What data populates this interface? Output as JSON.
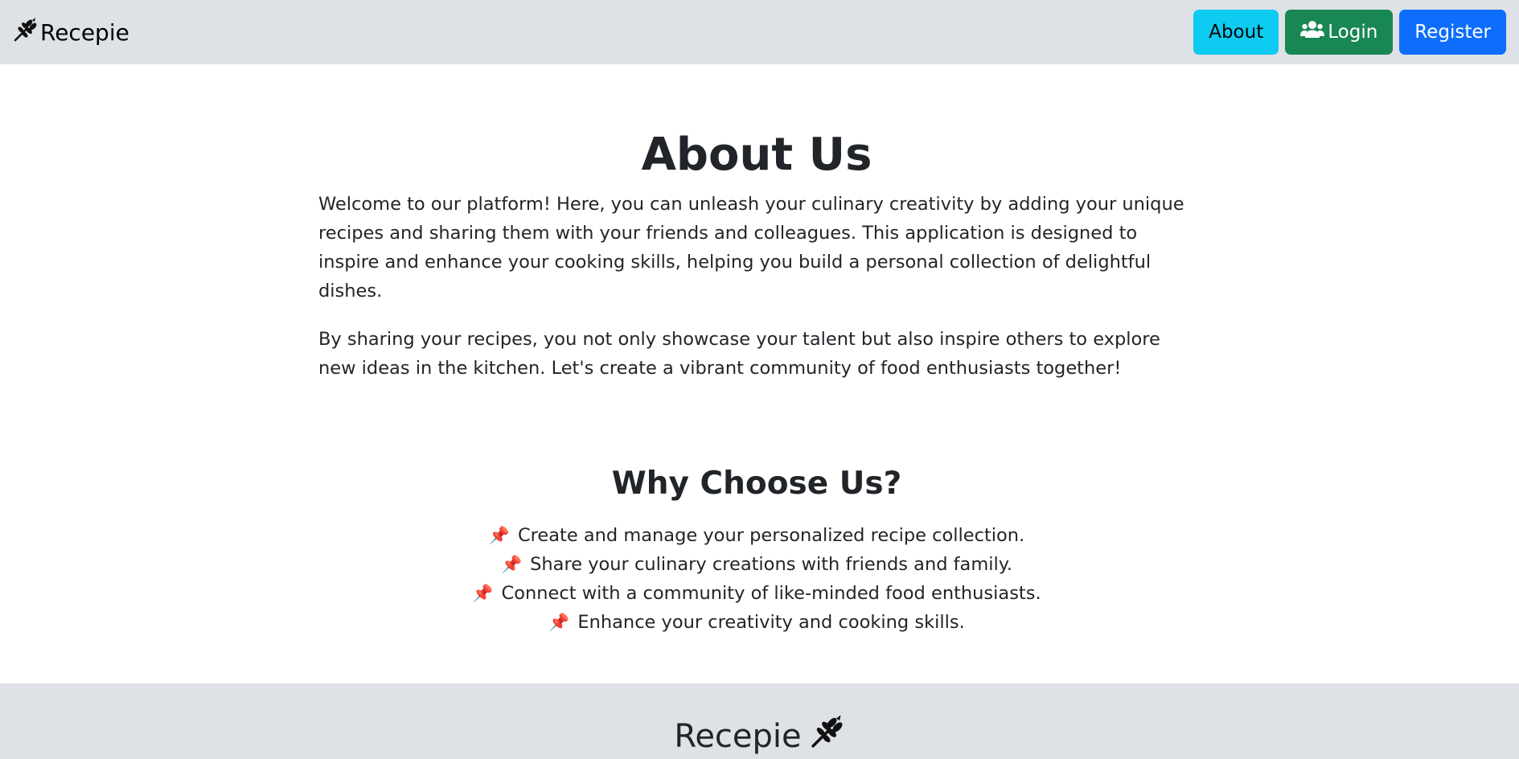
{
  "navbar": {
    "brand": "Recepie",
    "brand_icon": "wheat-icon",
    "about_label": "About",
    "login_label": "Login",
    "login_icon": "users-icon",
    "register_label": "Register",
    "colors": {
      "background": "#dee2e6",
      "about": "#0dcaf0",
      "login": "#198754",
      "register": "#0d6efd"
    }
  },
  "main": {
    "title": "About Us",
    "paragraphs": [
      "Welcome to our platform! Here, you can unleash your culinary creativity by adding your unique recipes and sharing them with your friends and colleagues. This application is designed to inspire and enhance your cooking skills, helping you build a personal collection of delightful dishes.",
      "By sharing your recipes, you not only showcase your talent but also inspire others to explore new ideas in the kitchen. Let's create a vibrant community of food enthusiasts together!"
    ],
    "why_title": "Why Choose Us?",
    "features": [
      {
        "icon": "📌",
        "text": "Create and manage your personalized recipe collection."
      },
      {
        "icon": "📌",
        "text": "Share your culinary creations with friends and family."
      },
      {
        "icon": "📌",
        "text": "Connect with a community of like-minded food enthusiasts."
      },
      {
        "icon": "📌",
        "text": "Enhance your creativity and cooking skills."
      }
    ]
  },
  "footer": {
    "brand": "Recepie",
    "brand_icon": "wheat-icon"
  }
}
